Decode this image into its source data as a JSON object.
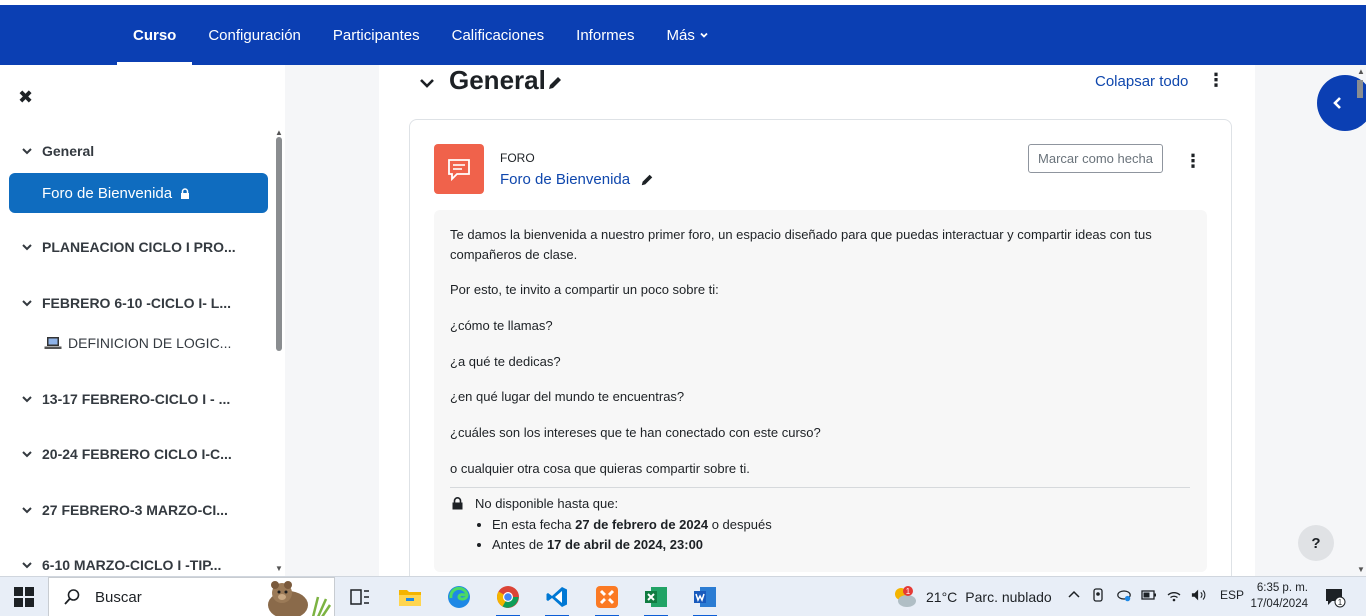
{
  "nav": {
    "items": [
      {
        "label": "Curso",
        "active": true
      },
      {
        "label": "Configuración"
      },
      {
        "label": "Participantes"
      },
      {
        "label": "Calificaciones"
      },
      {
        "label": "Informes"
      },
      {
        "label": "Más"
      }
    ]
  },
  "index": {
    "close_icon": "close-icon",
    "sections": [
      "General",
      "PLANEACION CICLO I PRO...",
      "FEBRERO 6-10 -CICLO I- L...",
      "13-17 FEBRERO-CICLO I - ...",
      "20-24 FEBRERO CICLO I-C...",
      "27 FEBRERO-3 MARZO-CI...",
      "6-10 MARZO-CICLO I -TIP..."
    ],
    "active_item": "Foro de Bienvenida",
    "activity_item": "DEFINICION DE LOGIC..."
  },
  "section": {
    "title": "General",
    "collapse_all": "Colapsar todo"
  },
  "activity": {
    "type": "FORO",
    "name": "Foro de Bienvenida",
    "mark_done": "Marcar como hecha",
    "icon_color": "#f0624b",
    "description": [
      "Te damos la bienvenida a nuestro primer foro, un espacio diseñado para que puedas interactuar y compartir ideas con tus compañeros de clase.",
      "Por esto, te invito a compartir un poco sobre ti:",
      "¿cómo te llamas?",
      "¿a qué te dedicas?",
      "¿en qué lugar del mundo te encuentras?",
      "¿cuáles son los intereses que te han conectado con este curso?",
      "o cualquier otra cosa que quieras compartir sobre ti."
    ],
    "restriction": {
      "heading": "No disponible hasta que:",
      "item1_pre": "En esta fecha ",
      "item1_bold": "27 de febrero de 2024",
      "item1_post": " o después",
      "item2_pre": "Antes de ",
      "item2_bold": "17 de abril de 2024, 23:00"
    }
  },
  "help": "?",
  "taskbar": {
    "search_placeholder": "Buscar",
    "weather_temp": "21°C",
    "weather_desc": "Parc. nublado",
    "weather_badge": "1",
    "lang": "ESP",
    "time": "6:35 p. m.",
    "date": "17/04/2024"
  },
  "colors": {
    "nav_bg": "#0b3fb3",
    "active_item_bg": "#0f6cbf",
    "link": "#0f47ad"
  }
}
